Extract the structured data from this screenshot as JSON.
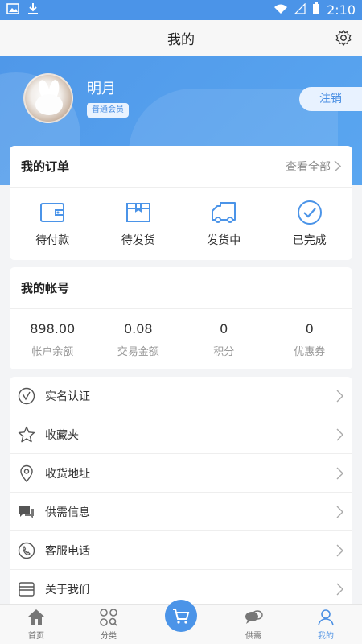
{
  "status_bar": {
    "time": "2:10"
  },
  "title_bar": {
    "title": "我的"
  },
  "profile": {
    "name": "明月",
    "badge": "普通会员",
    "logout_label": "注销"
  },
  "orders": {
    "title": "我的订单",
    "view_all": "查看全部",
    "items": [
      {
        "label": "待付款",
        "icon": "wallet-icon"
      },
      {
        "label": "待发货",
        "icon": "box-icon"
      },
      {
        "label": "发货中",
        "icon": "truck-icon"
      },
      {
        "label": "已完成",
        "icon": "check-circle-icon"
      }
    ]
  },
  "account": {
    "title": "我的帐号",
    "items": [
      {
        "value": "898.00",
        "label": "帐户余额"
      },
      {
        "value": "0.08",
        "label": "交易金额"
      },
      {
        "value": "0",
        "label": "积分"
      },
      {
        "value": "0",
        "label": "优惠券"
      }
    ]
  },
  "menu": {
    "items": [
      {
        "label": "实名认证",
        "icon": "verify-icon"
      },
      {
        "label": "收藏夹",
        "icon": "star-icon"
      },
      {
        "label": "收货地址",
        "icon": "location-icon"
      },
      {
        "label": "供需信息",
        "icon": "chat-icon"
      },
      {
        "label": "客服电话",
        "icon": "phone-icon"
      },
      {
        "label": "关于我们",
        "icon": "store-icon"
      }
    ]
  },
  "bottom_nav": {
    "items": [
      {
        "label": "首页",
        "icon": "home-icon"
      },
      {
        "label": "分类",
        "icon": "category-icon"
      },
      {
        "label": "",
        "icon": "cart-icon"
      },
      {
        "label": "供需",
        "icon": "chat-bubbles-icon"
      },
      {
        "label": "我的",
        "icon": "user-icon",
        "active": true
      }
    ]
  },
  "colors": {
    "accent": "#4b94e8",
    "header_bg": "#5aa6f0",
    "badge_text": "#4a8fe3"
  }
}
